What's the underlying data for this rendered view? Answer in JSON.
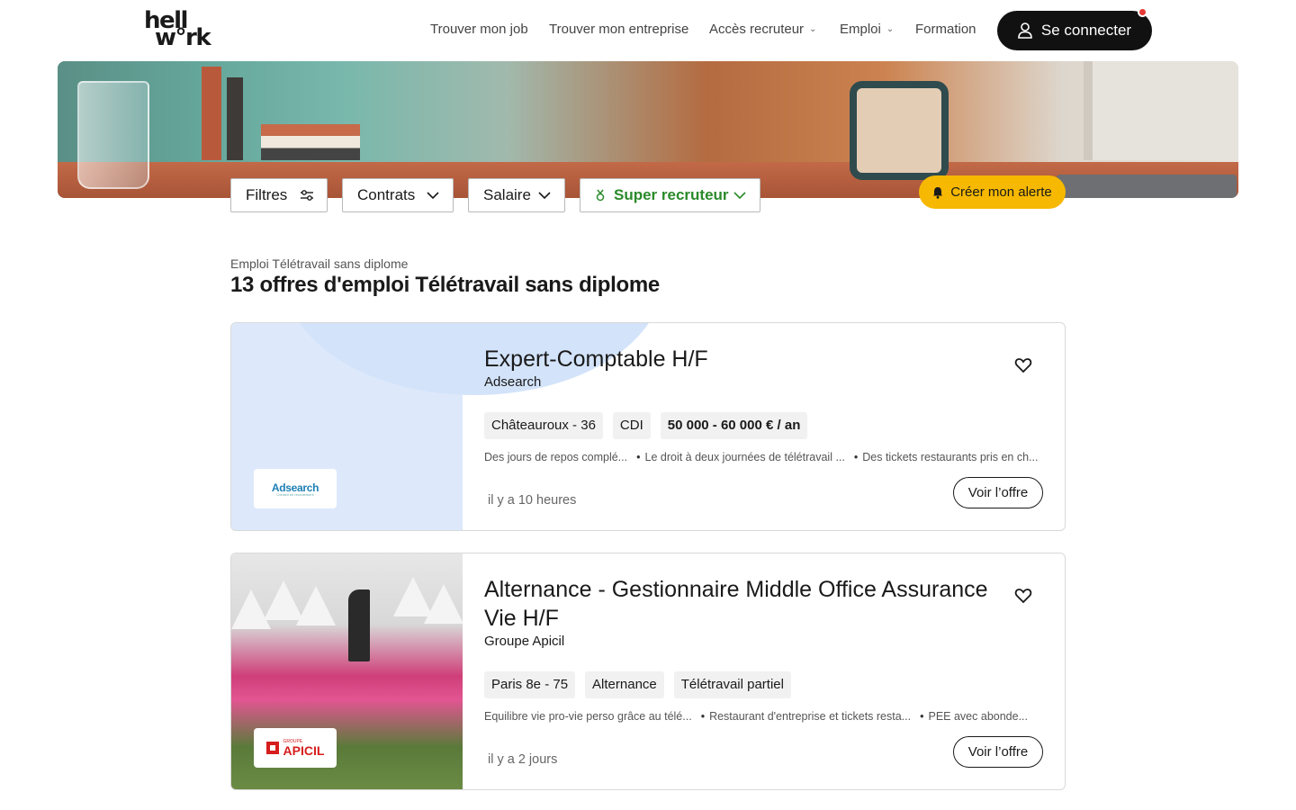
{
  "header": {
    "logo_line1": "hell",
    "logo_line2": "w°rk",
    "nav": [
      {
        "label": "Trouver mon job",
        "has_dropdown": false
      },
      {
        "label": "Trouver mon entreprise",
        "has_dropdown": false
      },
      {
        "label": "Accès recruteur",
        "has_dropdown": true
      },
      {
        "label": "Emploi",
        "has_dropdown": true
      },
      {
        "label": "Formation",
        "has_dropdown": false
      }
    ],
    "login_label": "Se connecter",
    "notification_color": "#e53935"
  },
  "filters": {
    "filtres_label": "Filtres",
    "contrats_label": "Contrats",
    "salaire_label": "Salaire",
    "super_label": "Super recruteur",
    "super_color": "#2a8a2a",
    "alert_label": "Créer mon alerte",
    "alert_color": "#f6b800"
  },
  "breadcrumb": "Emploi Télétravail sans diplome",
  "page_title": "13 offres d'emploi Télétravail sans diplome",
  "jobs": [
    {
      "title": "Expert-Comptable H/F",
      "company": "Adsearch",
      "logo_text": "Adsearch",
      "logo_subtext": "Conseil en recrutement",
      "tags": [
        "Châteauroux - 36",
        "CDI",
        "50 000 - 60 000 € / an"
      ],
      "perks": [
        "Des jours de repos complé...",
        "Le droit à deux journées de télétravail ...",
        "Des tickets restaurants pris en ch..."
      ],
      "posted": "il y a 10 heures",
      "cta": "Voir l’offre"
    },
    {
      "title": "Alternance - Gestionnaire Middle Office Assurance Vie H/F",
      "company": "Groupe Apicil",
      "logo_text": "APICIL",
      "logo_subtext": "GROUPE",
      "tags": [
        "Paris 8e - 75",
        "Alternance",
        "Télétravail partiel"
      ],
      "perks": [
        "Equilibre vie pro-vie perso grâce au télé...",
        "Restaurant d'entreprise et tickets resta...",
        "PEE avec abonde..."
      ],
      "posted": "il y a 2 jours",
      "cta": "Voir l’offre"
    }
  ]
}
